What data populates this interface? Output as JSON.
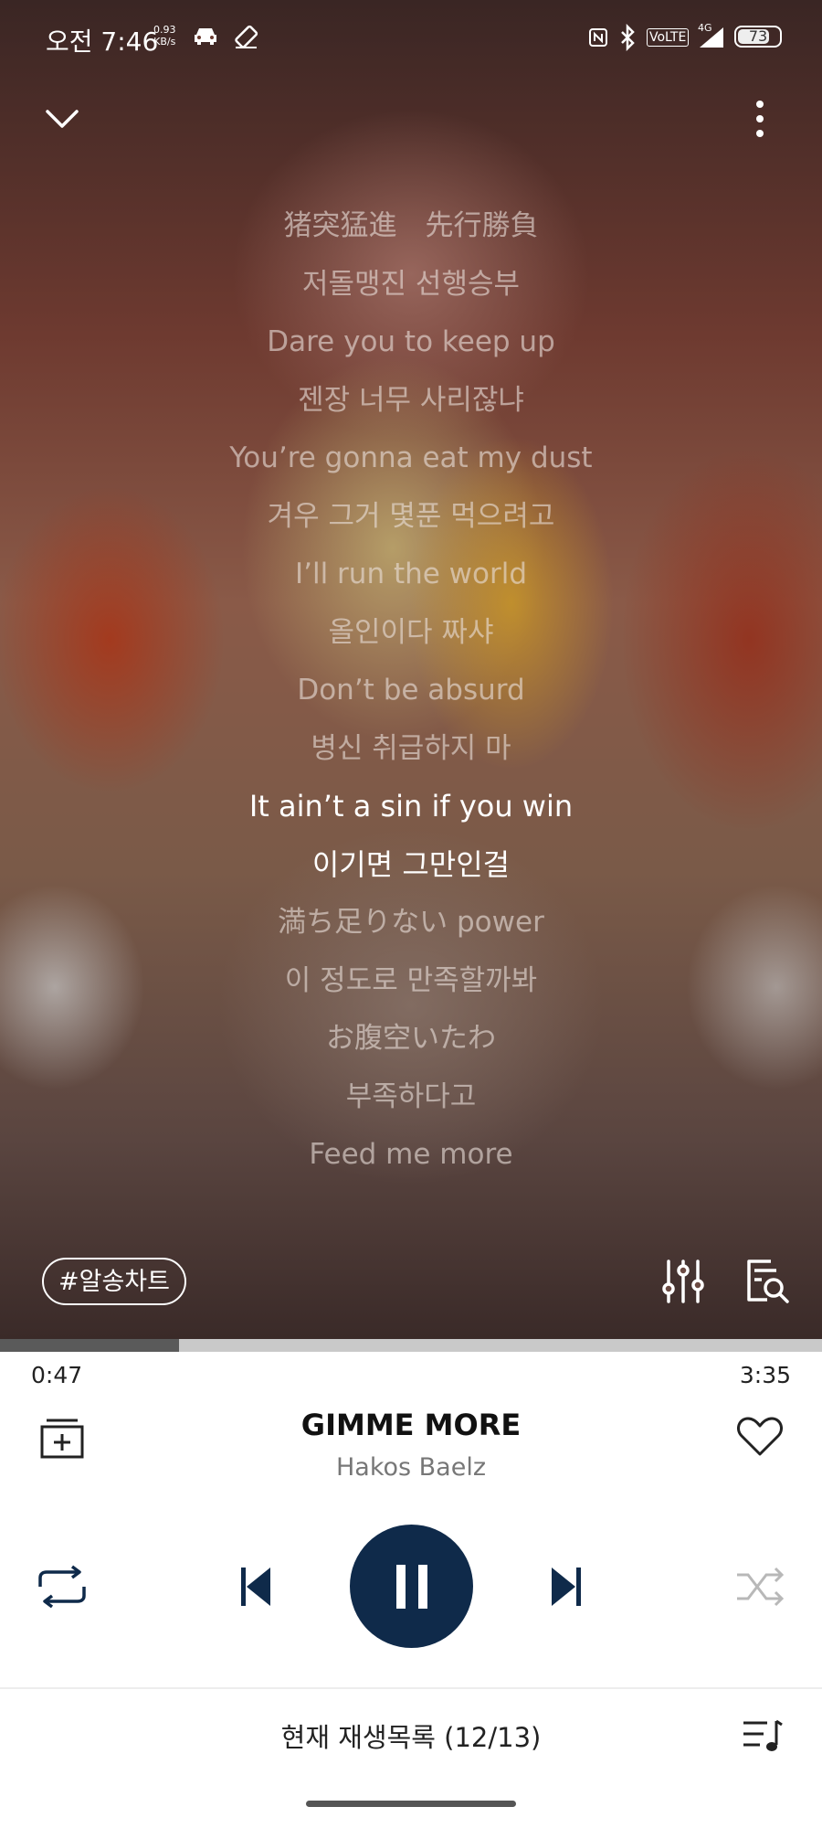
{
  "status_bar": {
    "time": "오전 7:46",
    "net_speed_value": "0.93",
    "net_speed_unit": "KB/s",
    "volte": "VoLTE",
    "network": "4G",
    "battery": "73"
  },
  "lyrics": [
    {
      "text": "猪突猛進　先行勝負",
      "active": false
    },
    {
      "text": "저돌맹진 선행승부",
      "active": false
    },
    {
      "text": "Dare you to keep up",
      "active": false
    },
    {
      "text": "젠장 너무 사리잖냐",
      "active": false
    },
    {
      "text": "You’re gonna eat my dust",
      "active": false
    },
    {
      "text": "겨우 그거 몇푼 먹으려고",
      "active": false
    },
    {
      "text": "I’ll run the world",
      "active": false
    },
    {
      "text": "올인이다 짜샤",
      "active": false
    },
    {
      "text": "Don’t be absurd",
      "active": false
    },
    {
      "text": "병신 취급하지 마",
      "active": false
    },
    {
      "text": "It ain’t a sin if you win",
      "active": true
    },
    {
      "text": "이기면 그만인걸",
      "active": true
    },
    {
      "text": "満ち足りない power",
      "active": false
    },
    {
      "text": "이 정도로 만족할까봐",
      "active": false
    },
    {
      "text": "お腹空いたわ",
      "active": false
    },
    {
      "text": "부족하다고",
      "active": false
    },
    {
      "text": "Feed me more",
      "active": false
    }
  ],
  "tag_chip": "#알송차트",
  "player": {
    "elapsed": "0:47",
    "duration": "3:35",
    "progress_fraction": 0.218,
    "title": "GIMME MORE",
    "artist": "Hakos Baelz",
    "accent_color": "#0f2a4a"
  },
  "playlist": {
    "label": "현재 재생목록 (12/13)"
  },
  "icons": {
    "collapse": "chevron-down-icon",
    "more": "more-vertical-icon",
    "equalizer": "equalizer-icon",
    "lyrics_search": "lyrics-search-icon",
    "add_to_playlist": "add-to-playlist-icon",
    "like": "heart-icon",
    "repeat": "repeat-icon",
    "previous": "skip-previous-icon",
    "pause": "pause-icon",
    "next": "skip-next-icon",
    "shuffle": "shuffle-icon",
    "playlist": "playlist-icon"
  }
}
